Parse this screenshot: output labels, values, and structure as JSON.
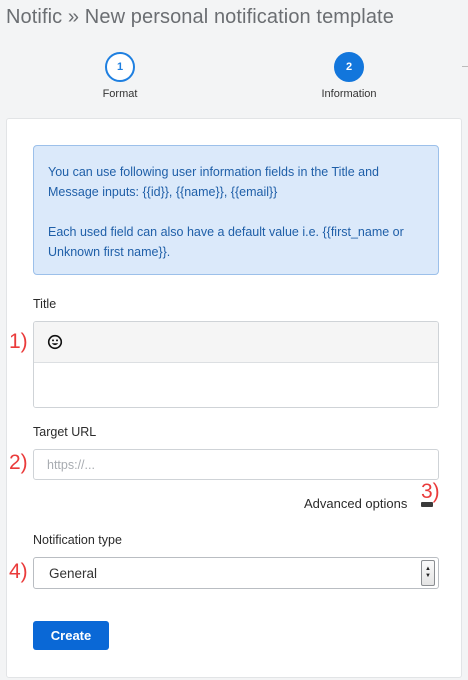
{
  "page": {
    "title": "Notific » New personal notification template"
  },
  "steps": [
    {
      "number": "1",
      "label": "Format",
      "state": "done"
    },
    {
      "number": "2",
      "label": "Information",
      "state": "active"
    }
  ],
  "info": {
    "paragraph1": "You can use following user information fields in the Title and Message inputs: {{id}}, {{name}}, {{email}}",
    "paragraph2": "Each used field can also have a default value i.e. {{first_name or Unknown first name}}."
  },
  "form": {
    "title_label": "Title",
    "title_value": "",
    "title_toolbar_icon": "emoji-icon",
    "target_url_label": "Target URL",
    "target_url_value": "",
    "target_url_placeholder": "https://...",
    "advanced_options": "Advanced options",
    "notification_type_label": "Notification type",
    "notification_type_value": "General",
    "create_button": "Create"
  },
  "annotations": {
    "m1": "1)",
    "m2": "2)",
    "m3": "3)",
    "m4": "4)"
  },
  "colors": {
    "primary": "#0a68d6",
    "info_bg": "#dbe9fa",
    "info_text": "#1f5fa8",
    "annotation": "#ea3b3b"
  }
}
